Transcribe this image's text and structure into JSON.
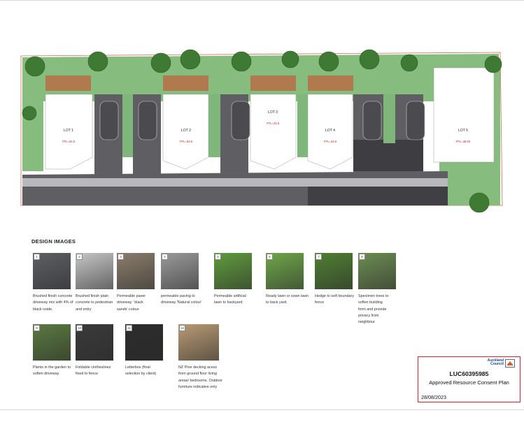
{
  "plan": {
    "lots": [
      {
        "label": "LOT 1",
        "ffl": "FFL=34.8"
      },
      {
        "label": "LOT 2",
        "ffl": "FFL=34.8"
      },
      {
        "label": "LOT 3",
        "ffl": "FFL=34.8"
      },
      {
        "label": "LOT 4",
        "ffl": "FFL=34.8"
      },
      {
        "label": "LOT 5",
        "ffl": "FFL=35.00"
      }
    ],
    "colors": {
      "grass": "#7fb77a",
      "concrete": "#5f5f63",
      "paving": "#b9b9bb",
      "deck": "#b07a4e",
      "building": "#ffffff",
      "boundary": "#d06a4e"
    }
  },
  "design": {
    "title": "DESIGN IMAGES",
    "items": [
      {
        "num": "1",
        "caption_lines": [
          "Brushed finish concrete",
          "driveway mix with 4% of",
          "black oxide."
        ],
        "color": "#5d5f64"
      },
      {
        "num": "2",
        "caption_lines": [
          "Brushed finish plain",
          "concrete to pedestrian",
          "and entry"
        ],
        "color": "#c6c6c6"
      },
      {
        "num": "3",
        "caption_lines": [
          "Permeable paver",
          "driveway ' black",
          "sands' colour"
        ],
        "color": "#8b7d6b"
      },
      {
        "num": "4",
        "caption_lines": [
          "permeable paving to",
          "driveway 'Natural colour'"
        ],
        "color": "#9a9a9a"
      },
      {
        "num": "5",
        "caption_lines": [
          "Permeable artificial",
          "lawn to backyard"
        ],
        "color": "#5f9b3d"
      },
      {
        "num": "6",
        "caption_lines": [
          "Ready lawn or sown lawn",
          "to back yard."
        ],
        "color": "#6fa64a"
      },
      {
        "num": "7",
        "caption_lines": [
          "Hedge to soft boundary",
          "fence"
        ],
        "color": "#4f7f33"
      },
      {
        "num": "8",
        "caption_lines": [
          "Specimen trees to",
          "soften building",
          "form and provide",
          "privacy from",
          "neighbour"
        ],
        "color": "#6c8c52"
      },
      {
        "num": "9",
        "caption_lines": [
          "Plants in the garden to",
          "soften driveway"
        ],
        "color": "#5a7a3f"
      },
      {
        "num": "10",
        "caption_lines": [
          "Foldable clotheslines",
          "fixed to fence"
        ],
        "color": "#3a3a3a"
      },
      {
        "num": "11",
        "caption_lines": [
          "Letterbox (final",
          "selection by client)"
        ],
        "color": "#2c2c2c"
      },
      {
        "num": "12",
        "caption_lines": [
          "NZ Pine decking acess",
          "from ground floor living",
          "areas/ bedrooms. Outdoor",
          "furniture indicative only"
        ],
        "color": "#b89a73"
      }
    ]
  },
  "stamp": {
    "council_line1": "Auckland",
    "council_line2": "Council",
    "code": "LUC60395985",
    "description": "Approved Resource Consent Plan",
    "date": "28/08/2023",
    "border_color": "#d6222a"
  }
}
